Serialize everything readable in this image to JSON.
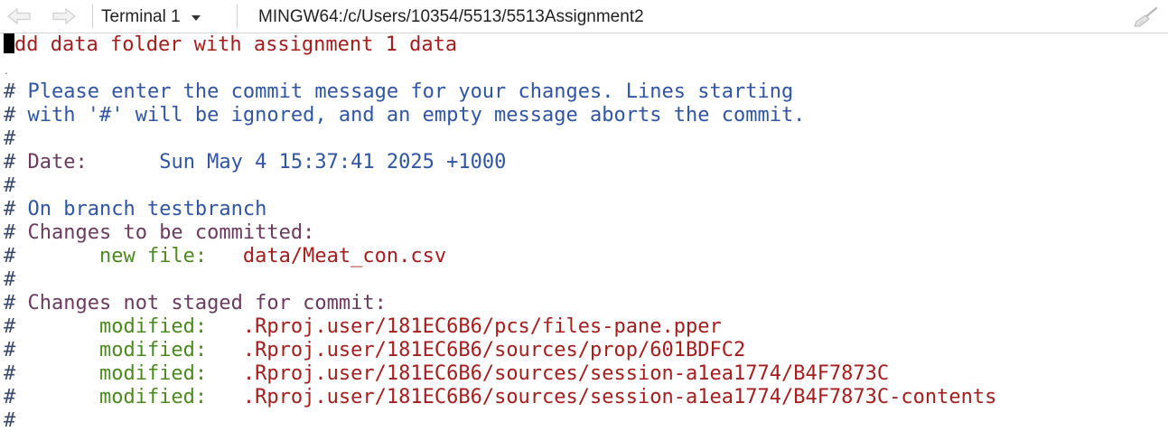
{
  "toolbar": {
    "terminal_label": "Terminal 1",
    "path": "MINGW64:/c/Users/10354/5513/5513Assignment2",
    "icons": {
      "back": "arrow-left-icon",
      "forward": "arrow-right-icon",
      "clear": "broom-icon"
    }
  },
  "colors": {
    "subject": "#a51d1d",
    "comment_blue": "#2f55a4",
    "comment_purple": "#6b3a5f",
    "status_green": "#4b8a1f",
    "path_red": "#a51d1d"
  },
  "editor": {
    "subject": "dd data folder with assignment 1 data",
    "dot": ".",
    "hash": "#",
    "comment_line1": " Please enter the commit message for your changes. Lines starting",
    "comment_line2": " with '#' will be ignored, and an empty message aborts the commit.",
    "date_label": " Date:      ",
    "date_value": "Sun May 4 15:37:41 2025 +1000",
    "branch_line": " On branch testbranch",
    "staged_header": " Changes to be committed:",
    "new_file_label": "       new file:   ",
    "new_file_path": "data/Meat_con.csv",
    "unstaged_header": " Changes not staged for commit:",
    "modified": [
      {
        "label": "       modified:   ",
        "path": ".Rproj.user/181EC6B6/pcs/files-pane.pper"
      },
      {
        "label": "       modified:   ",
        "path": ".Rproj.user/181EC6B6/sources/prop/601BDFC2"
      },
      {
        "label": "       modified:   ",
        "path": ".Rproj.user/181EC6B6/sources/session-a1ea1774/B4F7873C"
      },
      {
        "label": "       modified:   ",
        "path": ".Rproj.user/181EC6B6/sources/session-a1ea1774/B4F7873C-contents"
      }
    ]
  }
}
